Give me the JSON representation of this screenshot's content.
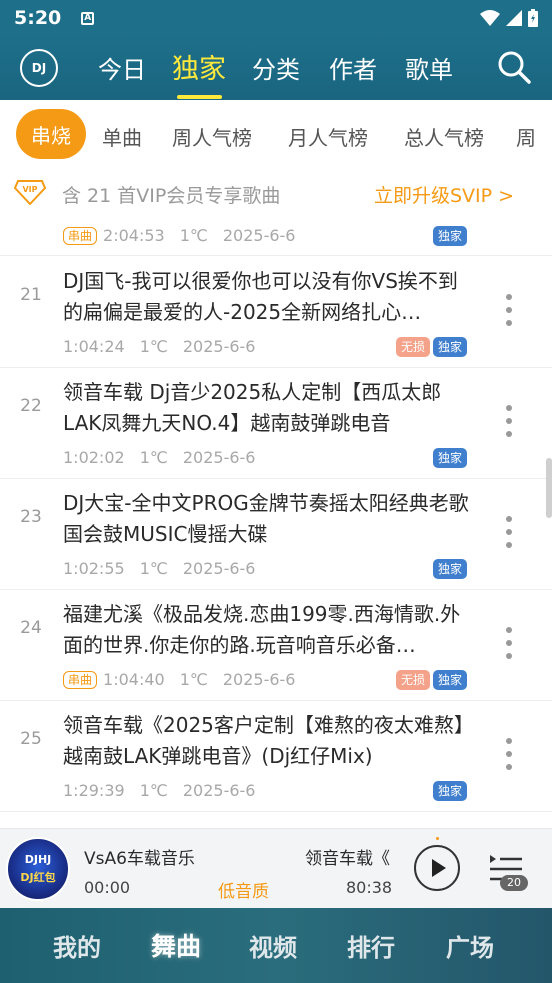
{
  "status_bar": {
    "time": "5:20",
    "notif_letter": "A"
  },
  "top_nav": {
    "tabs": [
      "今日",
      "独家",
      "分类",
      "作者",
      "歌单"
    ],
    "active_tab": "独家",
    "logo_text": "DJ"
  },
  "sub_tabs": [
    "串烧",
    "单曲",
    "周人气榜",
    "月人气榜",
    "总人气榜",
    "周"
  ],
  "vip_bar": {
    "text": "含 21 首VIP会员专享歌曲",
    "link": "立即升级SVIP >"
  },
  "previous_item": {
    "tag": "串曲",
    "duration": "2:04:53",
    "temp": "1℃",
    "date": "2025-6-6",
    "badges": [
      "独家"
    ]
  },
  "songs": [
    {
      "num": "21",
      "title": "DJ国飞-我可以很爱你也可以没有你VS挨不到的扁偏是最爱的人-2025全新网络扎心…",
      "tag": "",
      "duration": "1:04:24",
      "temp": "1℃",
      "date": "2025-6-6",
      "badges": [
        "无损",
        "独家"
      ]
    },
    {
      "num": "22",
      "title": "领音车载 Dj音少2025私人定制【西瓜太郎LAK凤舞九天NO.4】越南鼓弹跳电音",
      "tag": "",
      "duration": "1:02:02",
      "temp": "1℃",
      "date": "2025-6-6",
      "badges": [
        "独家"
      ]
    },
    {
      "num": "23",
      "title": "DJ大宝-全中文PROG金牌节奏摇太阳经典老歌国会鼓MUSIC慢摇大碟",
      "tag": "",
      "duration": "1:02:55",
      "temp": "1℃",
      "date": "2025-6-6",
      "badges": [
        "独家"
      ]
    },
    {
      "num": "24",
      "title": "福建尤溪《极品发烧.恋曲199零.西海情歌.外面的世界.你走你的路.玩音响音乐必备…",
      "tag": "串曲",
      "duration": "1:04:40",
      "temp": "1℃",
      "date": "2025-6-6",
      "badges": [
        "无损",
        "独家"
      ]
    },
    {
      "num": "25",
      "title": "领音车载《2025客户定制【难熬的夜太难熬】越南鼓LAK弹跳电音》(Dj红仔Mix)",
      "tag": "",
      "duration": "1:29:39",
      "temp": "1℃",
      "date": "2025-6-6",
      "badges": [
        "独家"
      ]
    }
  ],
  "player": {
    "title_left": "VsA6车载音乐",
    "title_right": "领音车载《",
    "current_time": "00:00",
    "quality": "低音质",
    "total_time": "80:38",
    "playlist_count": "20",
    "cover_text": "DJHJ",
    "cover_sub": "DJ红包"
  },
  "bottom_nav": {
    "items": [
      "我的",
      "舞曲",
      "视频",
      "排行",
      "广场"
    ],
    "active": "舞曲"
  },
  "colors": {
    "accent": "#f59a14",
    "header": "#1e6f8a",
    "highlight": "#ffe93b",
    "badge_exclusive": "#3f7fce",
    "badge_lossless": "#f4a28a"
  }
}
